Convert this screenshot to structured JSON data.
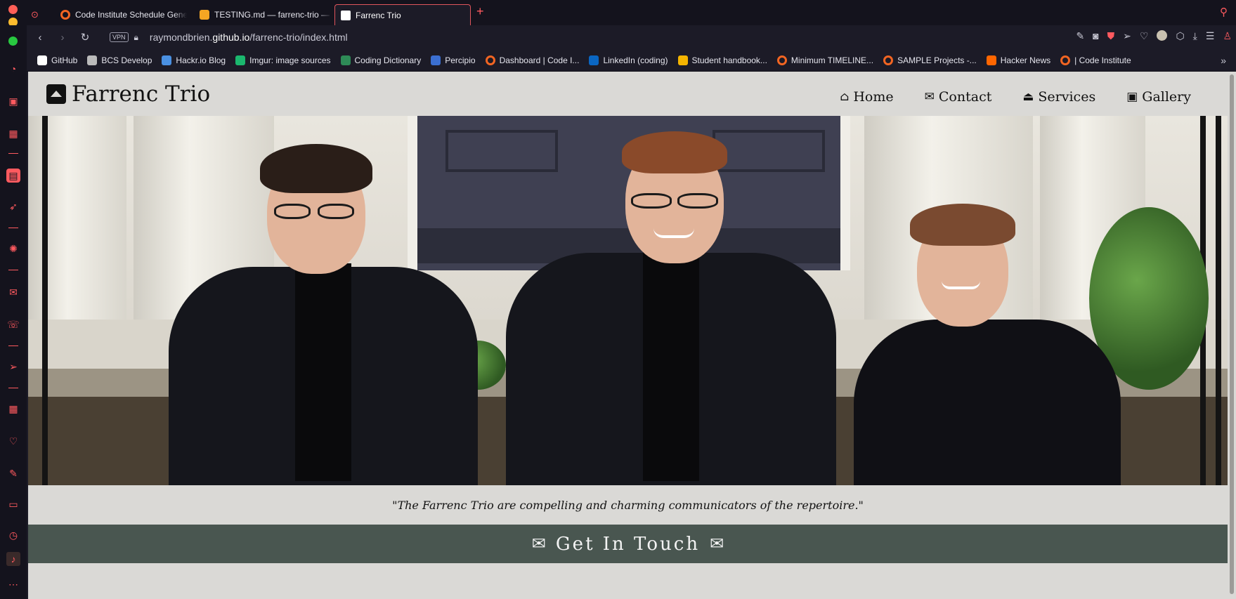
{
  "browser": {
    "tabs": [
      {
        "label": "Code Institute Schedule Genera",
        "active": false,
        "favicon_color": "#f26522"
      },
      {
        "label": "TESTING.md — farrenc-trio — G",
        "active": false,
        "favicon_color": "#f5a623"
      },
      {
        "label": "Farrenc Trio",
        "active": true,
        "favicon_color": "#ffffff"
      }
    ],
    "new_tab_symbol": "+",
    "vpn_label": "VPN",
    "url_prefix": "raymondbrien.",
    "url_domain": "github.io",
    "url_path": "/farrenc-trio/index.html",
    "bookmarks": [
      {
        "label": "GitHub",
        "color": "#ffffff"
      },
      {
        "label": "BCS Develop",
        "color": "#bbbbbb"
      },
      {
        "label": "Hackr.io Blog",
        "color": "#4a90e2"
      },
      {
        "label": "Imgur: image sources",
        "color": "#1bb76e"
      },
      {
        "label": "Coding Dictionary",
        "color": "#2e8b57"
      },
      {
        "label": "Percipio",
        "color": "#3b6fd1"
      },
      {
        "label": "Dashboard | Code I...",
        "color": "#f26522"
      },
      {
        "label": "LinkedIn (coding)",
        "color": "#0a66c2"
      },
      {
        "label": "Student handbook...",
        "color": "#f4b400"
      },
      {
        "label": "Minimum TIMELINE...",
        "color": "#f26522"
      },
      {
        "label": "SAMPLE Projects -...",
        "color": "#f26522"
      },
      {
        "label": "Hacker News",
        "color": "#ff6600"
      },
      {
        "label": "| Code Institute",
        "color": "#f26522"
      }
    ],
    "accent_color": "#ff5a5f"
  },
  "site": {
    "brand": "Farrenc Trio",
    "nav": [
      {
        "label": "Home",
        "icon": "home-icon"
      },
      {
        "label": "Contact",
        "icon": "envelope-icon"
      },
      {
        "label": "Services",
        "icon": "eject-icon"
      },
      {
        "label": "Gallery",
        "icon": "images-icon"
      }
    ],
    "hero_alt": "Farrenc Trio members seated on steps",
    "quote": "\"The Farrenc Trio are compelling and charming communicators of the repertoire.\"",
    "contact_heading": "Get In Touch",
    "contact_band_color": "#495650",
    "page_background": "#dad9d6"
  }
}
